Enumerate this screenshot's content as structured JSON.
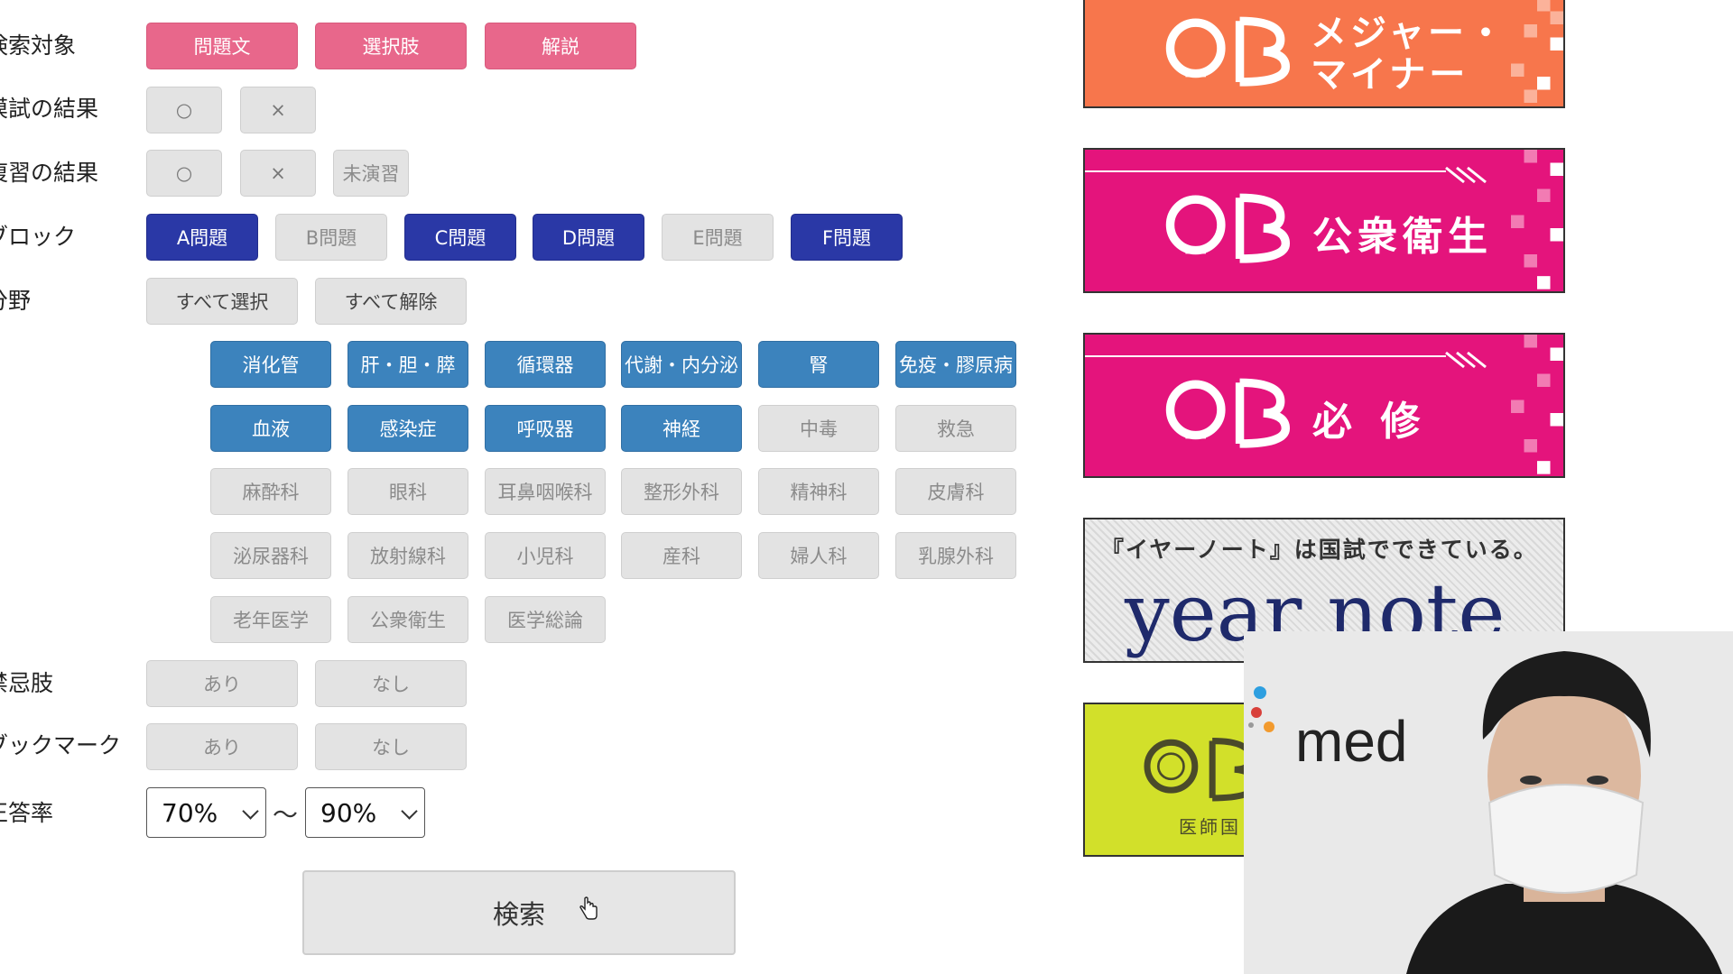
{
  "labels": {
    "search_target": "検索対象",
    "mock_result": "模試の結果",
    "review_result": "復習の結果",
    "block": "ブロック",
    "field": "分野",
    "contraindication": "禁忌肢",
    "bookmark": "ブックマーク",
    "accuracy": "正答率"
  },
  "search_target": [
    "問題文",
    "選択肢",
    "解説"
  ],
  "mock_result": [
    "○",
    "×"
  ],
  "review_result": [
    "○",
    "×",
    "未演習"
  ],
  "blocks": [
    "A問題",
    "B問題",
    "C問題",
    "D問題",
    "E問題",
    "F問題"
  ],
  "field_controls": [
    "すべて選択",
    "すべて解除"
  ],
  "fields": [
    [
      "消化管",
      "肝・胆・膵",
      "循環器",
      "代謝・内分泌",
      "腎",
      "免疫・膠原病"
    ],
    [
      "血液",
      "感染症",
      "呼吸器",
      "神経",
      "中毒",
      "救急"
    ],
    [
      "麻酔科",
      "眼科",
      "耳鼻咽喉科",
      "整形外科",
      "精神科",
      "皮膚科"
    ],
    [
      "泌尿器科",
      "放射線科",
      "小児科",
      "産科",
      "婦人科",
      "乳腺外科"
    ],
    [
      "老年医学",
      "公衆衛生",
      "医学総論"
    ]
  ],
  "contraindication_options": [
    "あり",
    "なし"
  ],
  "bookmark_options": [
    "あり",
    "なし"
  ],
  "accuracy": {
    "min": "70%",
    "max": "90%",
    "separator": "〜"
  },
  "search_button": "検索",
  "banners": {
    "major_minor": {
      "line1": "メジャー・",
      "line2": "マイナー",
      "color": "#f7764c"
    },
    "public_health": {
      "text": "公衆衛生",
      "color": "#e4147c"
    },
    "required": {
      "text": "必 修",
      "color": "#e4147c"
    },
    "year_note": {
      "tagline": "『イヤーノート』は国試でできている。",
      "title": "year note"
    },
    "qb_exam": {
      "caption": "医師国",
      "color": "#d2e02a"
    }
  },
  "webcam": {
    "brand_text": "med"
  },
  "colors": {
    "pink": "#e8678b",
    "navy": "#2a38a6",
    "blue": "#3c83bd",
    "gray": "#e3e3e3"
  }
}
